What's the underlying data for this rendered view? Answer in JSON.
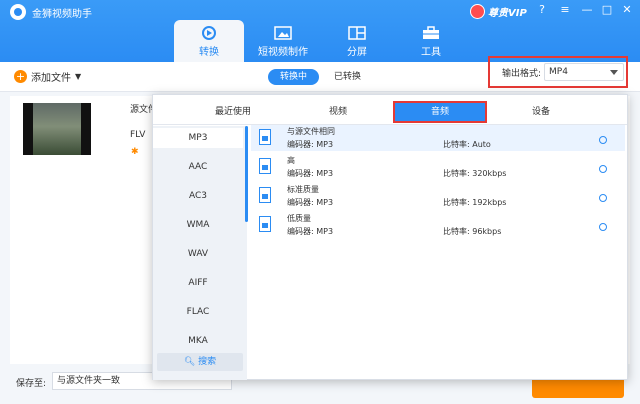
{
  "app": {
    "title": "金狮视频助手",
    "vip_label": "尊贵VIP"
  },
  "nav": {
    "tabs": [
      {
        "label": "转换",
        "icon": "convert-icon",
        "active": true
      },
      {
        "label": "短视频制作",
        "icon": "short-video-icon",
        "active": false
      },
      {
        "label": "分屏",
        "icon": "split-screen-icon",
        "active": false
      },
      {
        "label": "工具",
        "icon": "toolbox-icon",
        "active": false
      }
    ]
  },
  "window_controls": {
    "help": "?",
    "minimize": "—",
    "maximize": "□",
    "close": "✕"
  },
  "toolbar": {
    "add_file_label": "添加文件",
    "tab_converting": "转换中",
    "tab_converted": "已转换",
    "output_format_label": "输出格式:",
    "output_format_value": "MP4"
  },
  "file": {
    "name": "源文件",
    "format": "FLV"
  },
  "popup": {
    "tabs": [
      "最近使用",
      "视频",
      "音频",
      "设备"
    ],
    "active_tab": "音频",
    "formats": [
      "MP3",
      "AAC",
      "AC3",
      "WMA",
      "WAV",
      "AIFF",
      "FLAC",
      "MKA"
    ],
    "active_format": "MP3",
    "search_label": "搜索",
    "presets": [
      {
        "title": "与源文件相同",
        "codec": "编码器: MP3",
        "bitrate": "比特率: Auto"
      },
      {
        "title": "高",
        "codec": "编码器: MP3",
        "bitrate": "比特率: 320kbps"
      },
      {
        "title": "标准质量",
        "codec": "编码器: MP3",
        "bitrate": "比特率: 192kbps"
      },
      {
        "title": "低质量",
        "codec": "编码器: MP3",
        "bitrate": "比特率: 96kbps"
      }
    ]
  },
  "footer": {
    "save_to_label": "保存至:",
    "save_to_value": "与源文件夹一致"
  }
}
